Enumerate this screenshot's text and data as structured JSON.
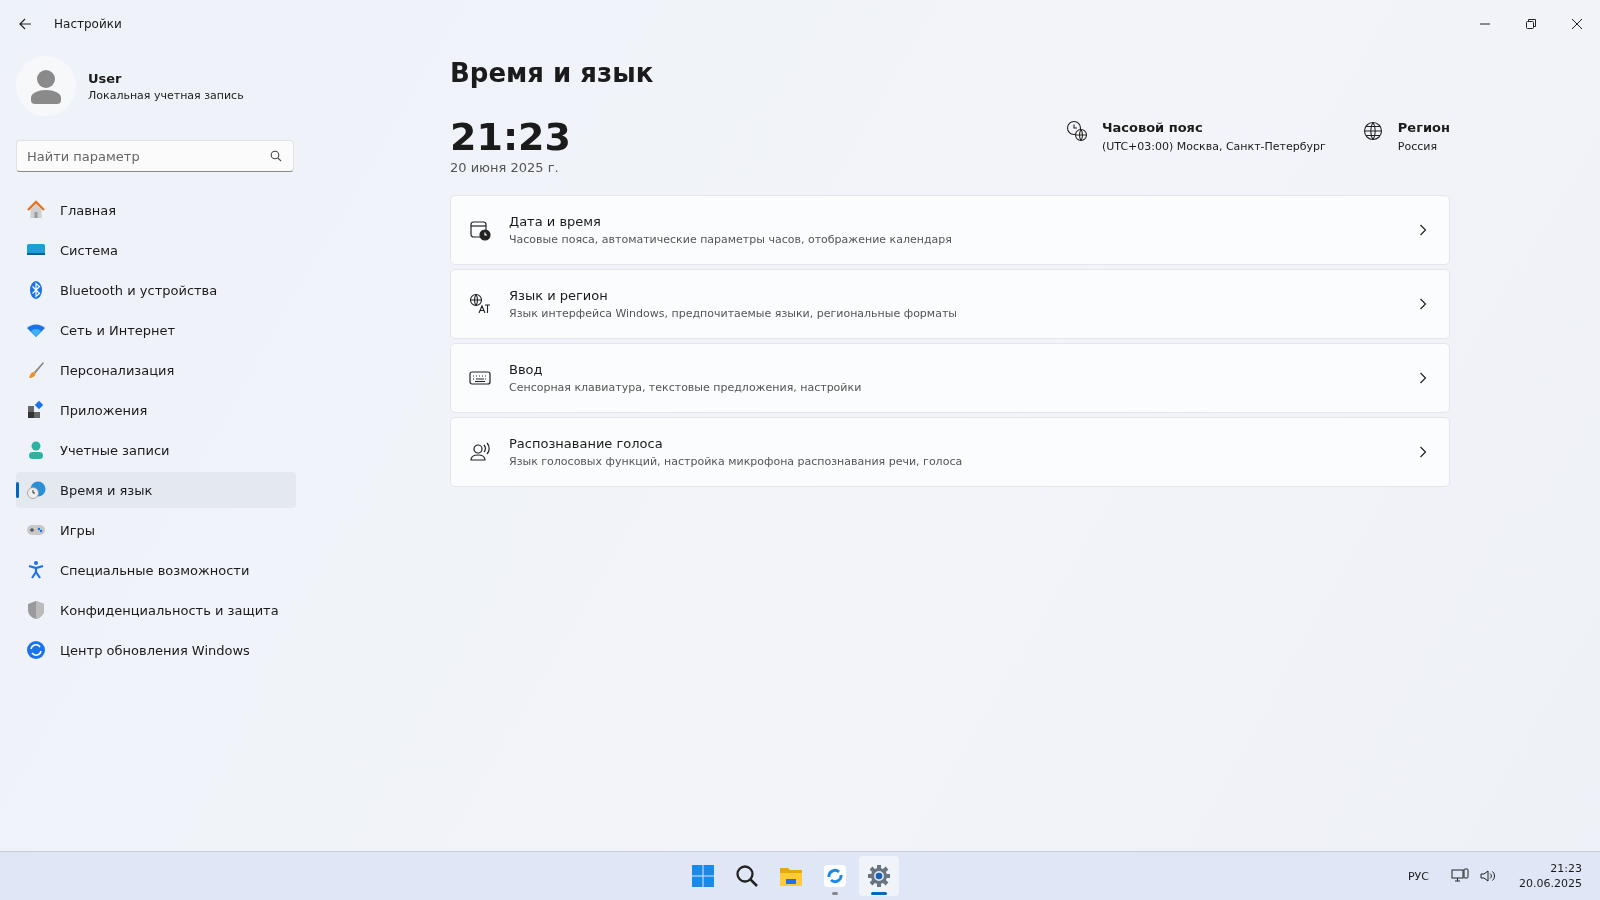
{
  "window": {
    "title": "Настройки"
  },
  "account": {
    "name": "User",
    "type": "Локальная учетная запись"
  },
  "search": {
    "placeholder": "Найти параметр"
  },
  "sidebar": {
    "items": [
      {
        "label": "Главная",
        "selected": false
      },
      {
        "label": "Система",
        "selected": false
      },
      {
        "label": "Bluetooth и устройства",
        "selected": false
      },
      {
        "label": "Сеть и Интернет",
        "selected": false
      },
      {
        "label": "Персонализация",
        "selected": false
      },
      {
        "label": "Приложения",
        "selected": false
      },
      {
        "label": "Учетные записи",
        "selected": false
      },
      {
        "label": "Время и язык",
        "selected": true
      },
      {
        "label": "Игры",
        "selected": false
      },
      {
        "label": "Специальные возможности",
        "selected": false
      },
      {
        "label": "Конфиденциальность и защита",
        "selected": false
      },
      {
        "label": "Центр обновления Windows",
        "selected": false
      }
    ]
  },
  "page": {
    "title": "Время и язык",
    "time": "21:23",
    "date": "20 июня 2025 г.",
    "info": [
      {
        "label": "Часовой пояс",
        "value": "(UTC+03:00) Москва, Санкт-Петербург"
      },
      {
        "label": "Регион",
        "value": "Россия"
      }
    ],
    "cards": [
      {
        "title": "Дата и время",
        "subtitle": "Часовые пояса, автоматические параметры часов, отображение календаря"
      },
      {
        "title": "Язык и регион",
        "subtitle": "Язык интерфейса Windows, предпочитаемые языки, региональные форматы"
      },
      {
        "title": "Ввод",
        "subtitle": "Сенсорная клавиатура, текстовые предложения, настройки"
      },
      {
        "title": "Распознавание голоса",
        "subtitle": "Язык голосовых функций, настройка микрофона распознавания речи, голоса"
      }
    ]
  },
  "taskbar": {
    "apps": [
      {
        "running": false,
        "selected": false
      },
      {
        "running": false,
        "selected": false
      },
      {
        "running": false,
        "selected": false
      },
      {
        "running": true,
        "selected": false
      },
      {
        "running": true,
        "selected": true
      }
    ],
    "language": "РУС",
    "time": "21:23",
    "date": "20.06.2025"
  }
}
